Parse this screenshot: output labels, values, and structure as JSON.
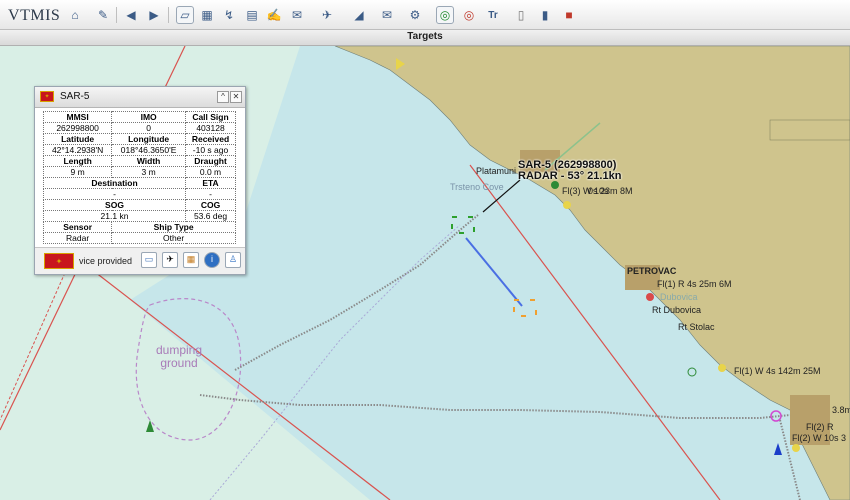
{
  "app": {
    "logo": "TMIS",
    "logo_prefix": "V"
  },
  "tab": {
    "title": "Targets"
  },
  "toolbar_icons": [
    "home-icon",
    "wrench-icon",
    "arrow-left-icon",
    "arrow-right-icon",
    "layers-icon",
    "map-icon",
    "route-icon",
    "report-icon",
    "edit-icon",
    "mail-icon",
    "satellite-icon",
    "filter-icon",
    "message-icon",
    "gear-icon",
    "radar-on-icon",
    "radar-off-icon",
    "text-icon",
    "document-icon",
    "book-icon",
    "flag-icon"
  ],
  "target": {
    "name": "SAR-5",
    "label_line1": "SAR-5 (262998800)",
    "label_line2": "RADAR - 53° 21.1kn"
  },
  "panel": {
    "title": "SAR-5",
    "mmsi_label": "MMSI",
    "mmsi": "262998800",
    "imo_label": "IMO",
    "imo": "0",
    "callsign_label": "Call Sign",
    "callsign": "403128",
    "lat_label": "Latitude",
    "lat": "42°14.2938'N",
    "lon_label": "Longitude",
    "lon": "018°46.3650'E",
    "received_label": "Received",
    "received": "-10 s ago",
    "length_label": "Length",
    "length": "9 m",
    "width_label": "Width",
    "width": "3 m",
    "draught_label": "Draught",
    "draught": "0.0 m",
    "destination_label": "Destination",
    "destination": "-",
    "eta_label": "ETA",
    "eta": "-",
    "sog_label": "SOG",
    "sog": "21.1 kn",
    "cog_label": "COG",
    "cog": "53.6 deg",
    "sensor_label": "Sensor",
    "sensor": "Radar",
    "shiptype_label": "Ship Type",
    "shiptype": "Other",
    "provided": "vice provided b"
  },
  "map_labels": {
    "platamuni": "Platamuni",
    "trsteno": "Trsteno Cove",
    "dumping1": "dumping",
    "dumping2": "ground",
    "petrovac": "PETROVAC",
    "rt_dubovica": "Rt Dubovica",
    "dubovica": "Dubovica",
    "rt_stolac": "Rt Stolac",
    "light1": "Fl(3) W 10s 23m 8M",
    "light1b": "Fl(3) W 10s",
    "light2": "Fl(1) R 4s 25m 6M",
    "light3": "Fl(1) W 4s 142m 25M",
    "light4": "Fl(2) R",
    "light5": "Fl(2) W 10s 3",
    "light6": "3.8m",
    "light7": "0s 23m 8M"
  },
  "colors": {
    "sea_shallow": "#d9efe6",
    "sea_deep": "#c6e6ea",
    "land": "#cfc48d",
    "town": "#b8a06a",
    "track": "#888888",
    "border": "#d9534f"
  }
}
